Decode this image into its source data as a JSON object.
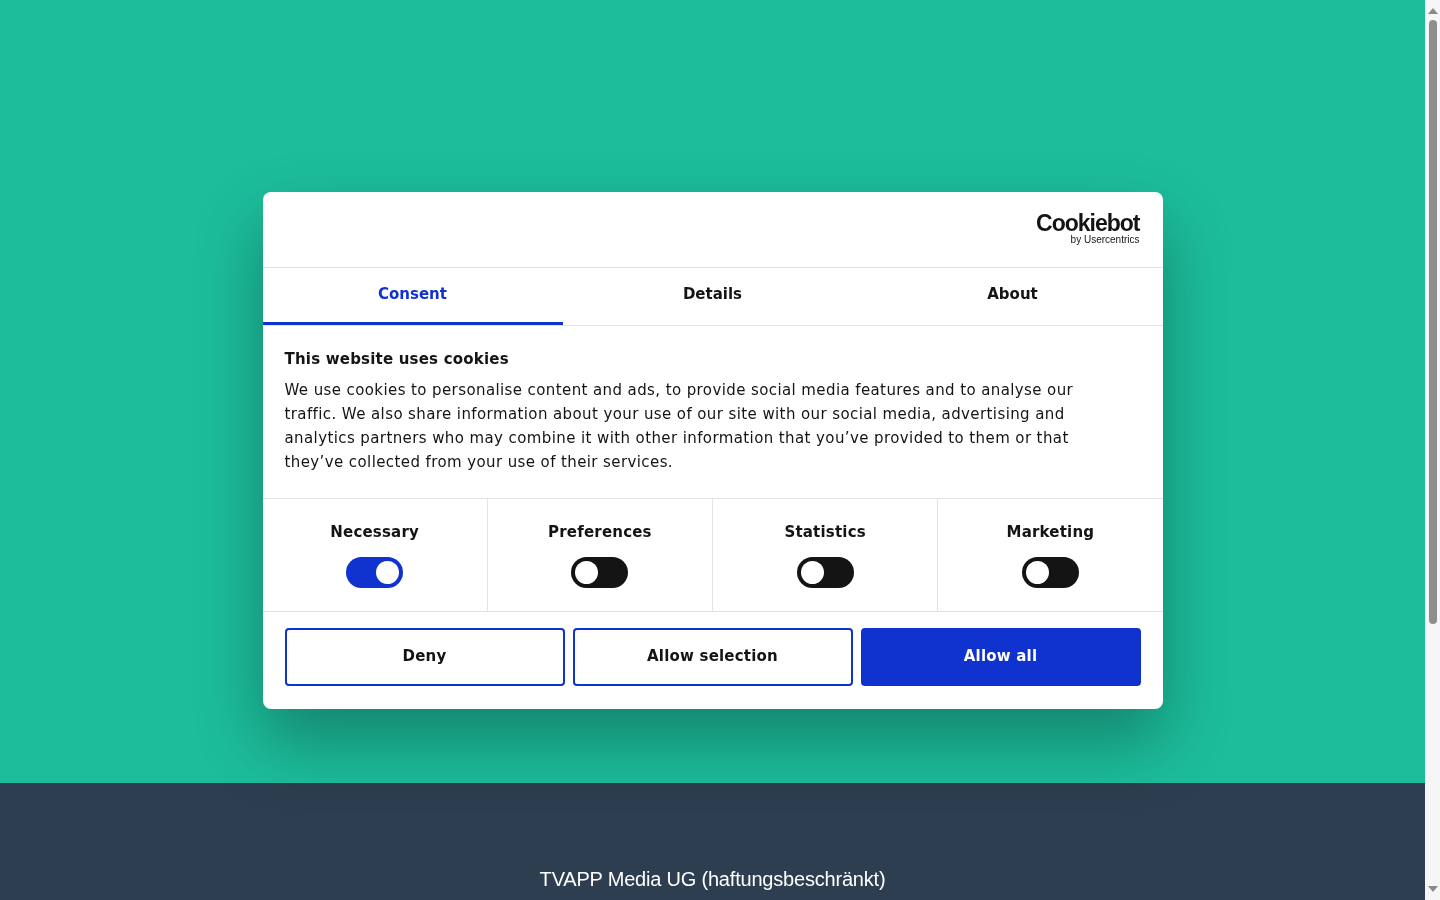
{
  "logo": {
    "wordmark": "Cookiebot",
    "byline": "by Usercentrics"
  },
  "tabs": [
    {
      "label": "Consent",
      "selected": true
    },
    {
      "label": "Details",
      "selected": false
    },
    {
      "label": "About",
      "selected": false
    }
  ],
  "consent": {
    "title": "This website uses cookies",
    "text": "We use cookies to personalise content and ads, to provide social media features and to analyse our traffic. We also share information about your use of our site with our social media, advertising and analytics partners who may combine it with other information that you’ve provided to them or that they’ve collected from your use of their services."
  },
  "categories": [
    {
      "label": "Necessary",
      "on": true
    },
    {
      "label": "Preferences",
      "on": false
    },
    {
      "label": "Statistics",
      "on": false
    },
    {
      "label": "Marketing",
      "on": false
    }
  ],
  "buttons": [
    {
      "label": "Deny",
      "kind": "outline"
    },
    {
      "label": "Allow selection",
      "kind": "outline"
    },
    {
      "label": "Allow all",
      "kind": "primary"
    }
  ],
  "footer": {
    "company": "TVAPP Media UG (haftungsbeschränkt)"
  }
}
